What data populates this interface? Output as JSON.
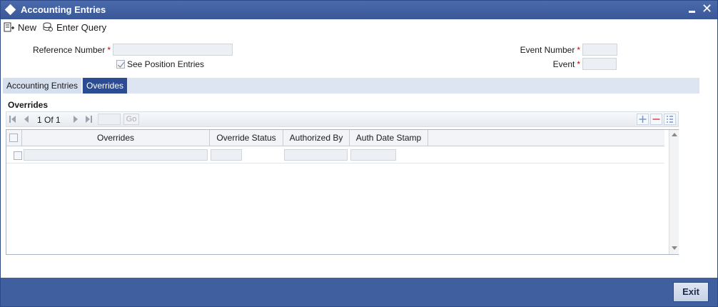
{
  "window": {
    "title": "Accounting Entries"
  },
  "toolbar": {
    "new_label": "New",
    "enter_query_label": "Enter Query"
  },
  "form": {
    "reference_number_label": "Reference Number",
    "reference_number_value": "",
    "see_position_label": "See Position Entries",
    "see_position_checked": true,
    "event_number_label": "Event Number",
    "event_number_value": "",
    "event_label": "Event",
    "event_value": "",
    "required_mark": "*"
  },
  "tabs": [
    {
      "label": "Accounting Entries",
      "active": false
    },
    {
      "label": "Overrides",
      "active": true
    }
  ],
  "overrides_section": {
    "title": "Overrides",
    "pager": {
      "current": "1",
      "of_label": "Of",
      "total": "1",
      "go_label": "Go"
    },
    "columns": [
      "Overrides",
      "Override Status",
      "Authorized By",
      "Auth Date Stamp"
    ],
    "rows": [
      {
        "overrides": "",
        "override_status": "",
        "authorized_by": "",
        "auth_date_stamp": ""
      }
    ]
  },
  "footer": {
    "exit_label": "Exit"
  },
  "colors": {
    "titlebar": "#3a5898",
    "footer": "#3f5f9f",
    "active_tab": "#2b4c93",
    "required": "#cc0000"
  }
}
